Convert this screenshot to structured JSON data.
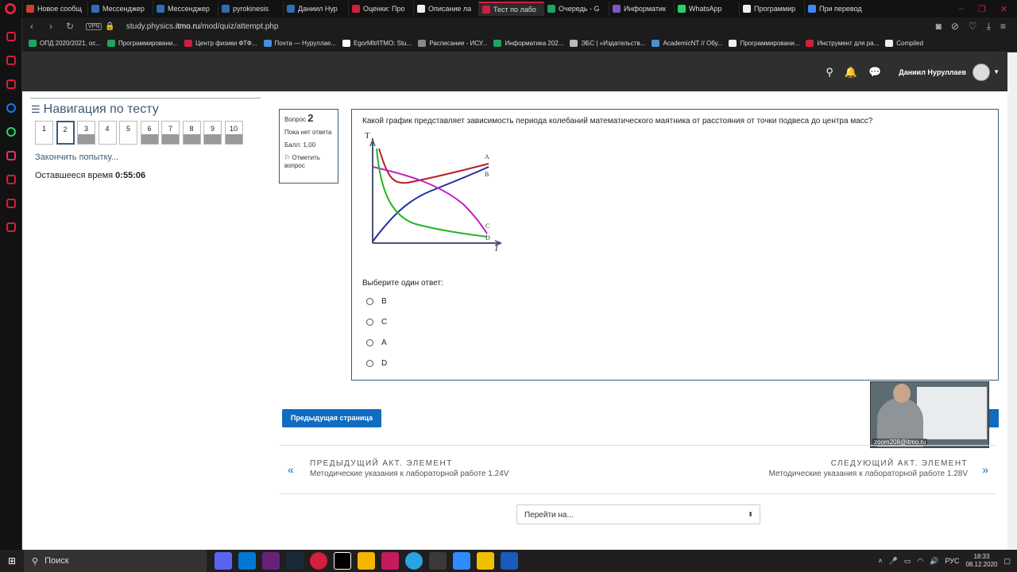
{
  "browser": {
    "tabs": [
      {
        "label": "Новое сообщ",
        "color": "#c7412c"
      },
      {
        "label": "Мессенджер",
        "color": "#2f6eb5"
      },
      {
        "label": "Мессенджер",
        "color": "#2f6eb5"
      },
      {
        "label": "pyrokinesis",
        "color": "#2f6eb5"
      },
      {
        "label": "Даниил Нур",
        "color": "#2f6eb5"
      },
      {
        "label": "Оценки: Про",
        "color": "#d01f3f"
      },
      {
        "label": "Описание ла",
        "color": "#eeeeee"
      },
      {
        "label": "Тест по лабо",
        "color": "#d01f3f",
        "active": true
      },
      {
        "label": "Очередь - G",
        "color": "#1fa463"
      },
      {
        "label": "Информатик",
        "color": "#7e57c2"
      },
      {
        "label": "WhatsApp",
        "color": "#25d366"
      },
      {
        "label": "Программир",
        "color": "#eeeeee"
      },
      {
        "label": "При перевод",
        "color": "#4285f4"
      }
    ],
    "vpn_label": "VPN",
    "address_prefix": "study.physics.",
    "address_domain": "itmo.ru",
    "address_path": "/mod/quiz/attempt.php",
    "bookmarks": [
      {
        "label": "ОПД 2020/2021, ос...",
        "color": "#1fa463"
      },
      {
        "label": "Программировани...",
        "color": "#1fa463"
      },
      {
        "label": "Центр физики ФТФ...",
        "color": "#d01f3f"
      },
      {
        "label": "Почта — Нуруллае...",
        "color": "#4a90d9"
      },
      {
        "label": "EgorMIt/ITMO: Stu...",
        "color": "#ffffff"
      },
      {
        "label": "Расписание - ИСУ...",
        "color": "#888888"
      },
      {
        "label": "Информатика 202...",
        "color": "#1fa463"
      },
      {
        "label": "ЭБС | «Издательств...",
        "color": "#bbbbbb"
      },
      {
        "label": "AcademicNT // Обу...",
        "color": "#4a90d9"
      },
      {
        "label": "Программировани...",
        "color": "#eeeeee"
      },
      {
        "label": "Инструмент для ра...",
        "color": "#d01f3f"
      },
      {
        "label": "Compiled",
        "color": "#eeeeee"
      }
    ]
  },
  "header": {
    "user_name": "Даниил Нуруллаев"
  },
  "quiz_nav": {
    "title": "Навигация по тесту",
    "buttons": [
      {
        "num": "1",
        "filled": false,
        "current": false
      },
      {
        "num": "2",
        "filled": false,
        "current": true
      },
      {
        "num": "3",
        "filled": true,
        "current": false
      },
      {
        "num": "4",
        "filled": false,
        "current": false
      },
      {
        "num": "5",
        "filled": false,
        "current": false
      },
      {
        "num": "6",
        "filled": true,
        "current": false
      },
      {
        "num": "7",
        "filled": true,
        "current": false
      },
      {
        "num": "8",
        "filled": true,
        "current": false
      },
      {
        "num": "9",
        "filled": true,
        "current": false
      },
      {
        "num": "10",
        "filled": true,
        "current": false
      }
    ],
    "finish_link": "Закончить попытку...",
    "timer_label": "Оставшееся время",
    "timer_value": "0:55:06"
  },
  "question_info": {
    "label": "Вопрос",
    "number": "2",
    "state": "Пока нет ответа",
    "grade": "Балл: 1,00",
    "flag": "Отметить вопрос"
  },
  "question": {
    "text": "Какой график представляет зависимость периода колебаний математического маятника от расстояния от точки подвеса до центра масс?",
    "graph_labels": {
      "y_axis": "T",
      "x_axis": "l",
      "curves": [
        "A",
        "B",
        "C",
        "D"
      ]
    },
    "curve_colors": {
      "A": "#b22222",
      "B": "#1f2fa0",
      "C": "#c020c0",
      "D": "#22b722"
    },
    "prompt": "Выберите один ответ:",
    "options": [
      "B",
      "C",
      "A",
      "D"
    ]
  },
  "buttons": {
    "prev_page": "Предыдущая страница"
  },
  "video": {
    "label": "zoom208@itmo.ru"
  },
  "activity_nav": {
    "prev_label": "ПРЕДЫДУЩИЙ АКТ. ЭЛЕМЕНТ",
    "prev_name": "Методические указания к лабораторной работе 1.24V",
    "next_label": "СЛЕДУЮЩИЙ АКТ. ЭЛЕМЕНТ",
    "next_name": "Методические указания к лабораторной работе 1.28V"
  },
  "jump": {
    "placeholder": "Перейти на..."
  },
  "taskbar": {
    "search": "Поиск",
    "lang": "РУС",
    "time": "18:33",
    "date": "08.12.2020"
  }
}
